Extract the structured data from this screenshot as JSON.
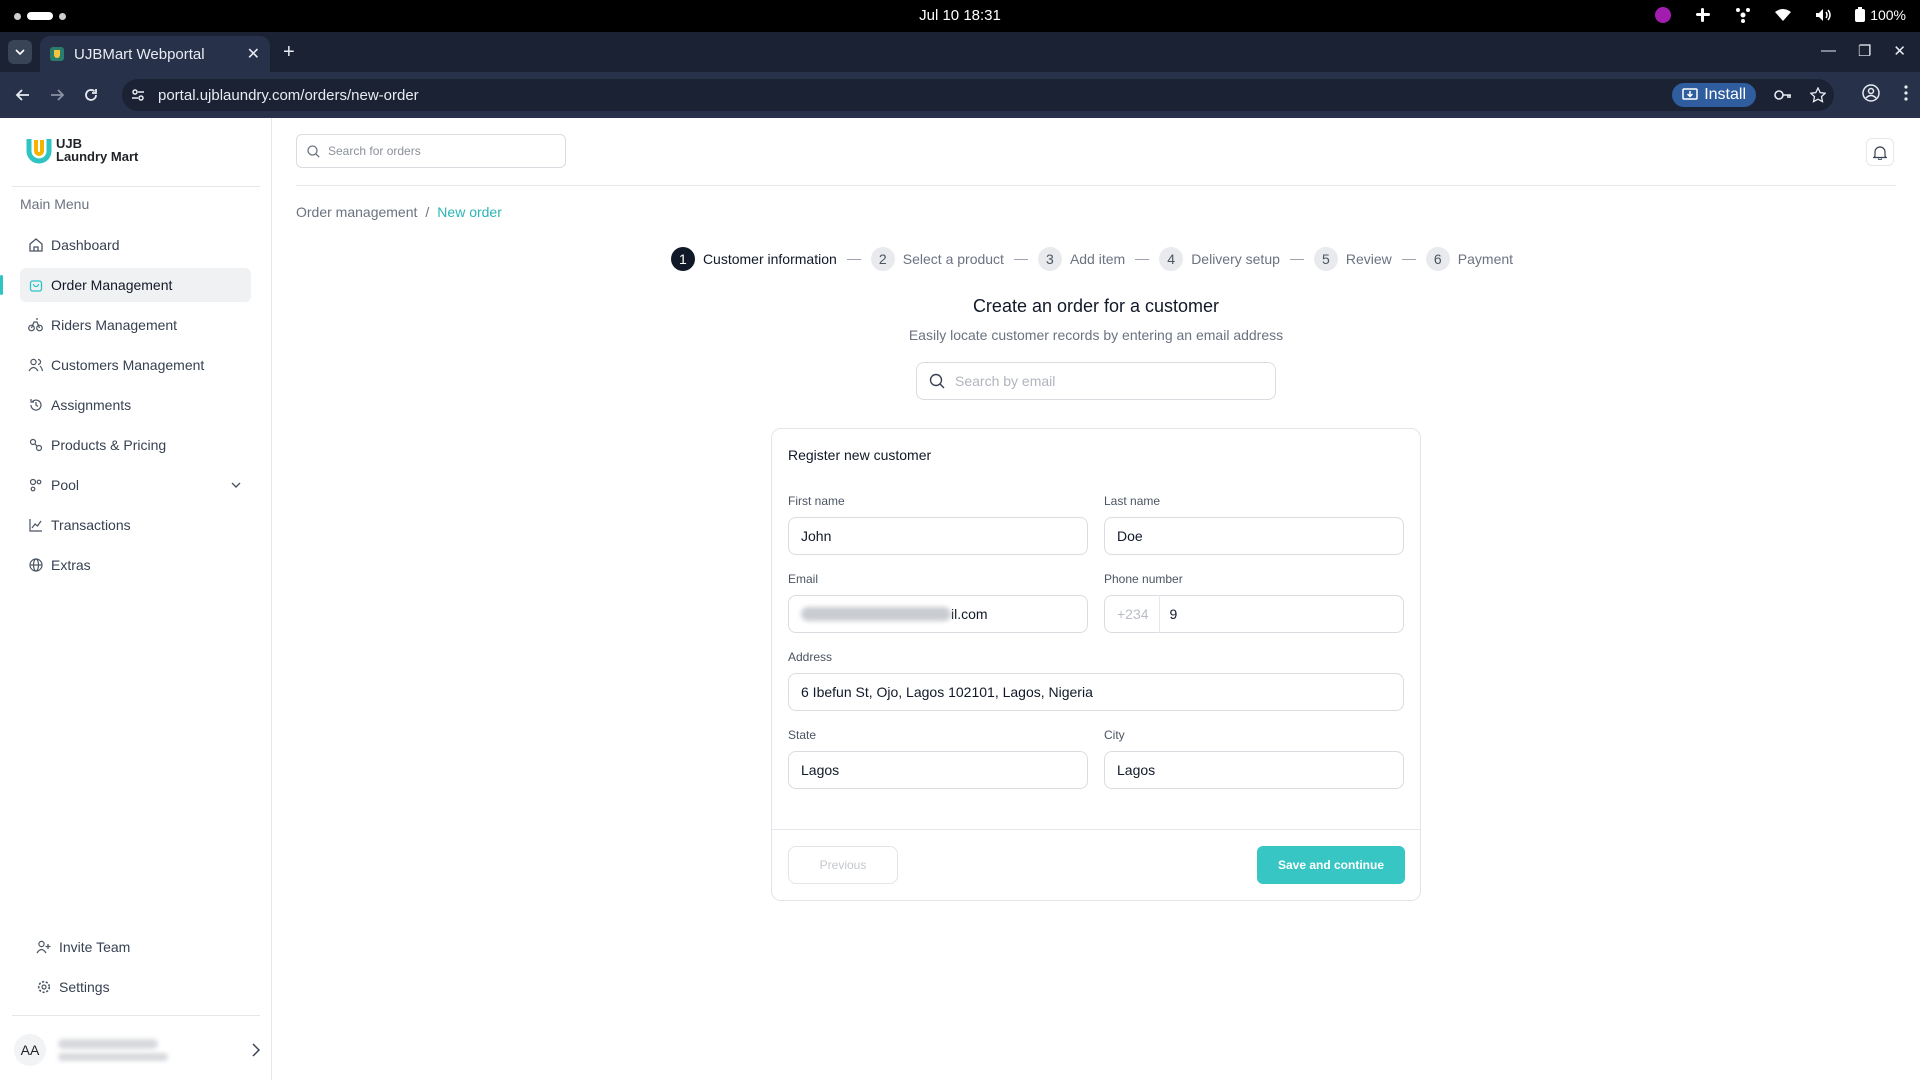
{
  "os": {
    "clock": "Jul 10  18:31",
    "battery": "100%"
  },
  "browser": {
    "tab_title": "UJBMart Webportal",
    "url": "portal.ujblaundry.com/orders/new-order",
    "install_label": "Install"
  },
  "sidebar": {
    "logo_line1": "UJB",
    "logo_line2": "Laundry Mart",
    "menu_title": "Main Menu",
    "items": [
      {
        "label": "Dashboard"
      },
      {
        "label": "Order Management"
      },
      {
        "label": "Riders Management"
      },
      {
        "label": "Customers Management"
      },
      {
        "label": "Assignments"
      },
      {
        "label": "Products & Pricing"
      },
      {
        "label": "Pool"
      },
      {
        "label": "Transactions"
      },
      {
        "label": "Extras"
      }
    ],
    "bottom": [
      {
        "label": "Invite Team"
      },
      {
        "label": "Settings"
      }
    ],
    "user_initials": "AA"
  },
  "header": {
    "search_placeholder": "Search for orders"
  },
  "breadcrumb": {
    "parent": "Order management",
    "separator": "/",
    "current": "New order"
  },
  "steps": [
    {
      "num": "1",
      "label": "Customer information"
    },
    {
      "num": "2",
      "label": "Select a product"
    },
    {
      "num": "3",
      "label": "Add item"
    },
    {
      "num": "4",
      "label": "Delivery setup"
    },
    {
      "num": "5",
      "label": "Review"
    },
    {
      "num": "6",
      "label": "Payment"
    }
  ],
  "main": {
    "title": "Create an order for a customer",
    "subtitle": "Easily locate customer records by entering an email address",
    "email_search_placeholder": "Search by email"
  },
  "form": {
    "title": "Register new customer",
    "first_name_label": "First name",
    "first_name": "John",
    "last_name_label": "Last name",
    "last_name": "Doe",
    "email_label": "Email",
    "email_visible_suffix": "il.com",
    "phone_label": "Phone number",
    "phone_prefix": "+234",
    "phone_visible_suffix": "9",
    "address_label": "Address",
    "address": "6 Ibefun St, Ojo, Lagos 102101, Lagos, Nigeria",
    "state_label": "State",
    "state": "Lagos",
    "city_label": "City",
    "city": "Lagos",
    "previous_label": "Previous",
    "save_label": "Save and continue"
  },
  "colors": {
    "accent": "#38c6c4",
    "breadcrumb_current": "#2bb5b5",
    "active_step": "#111827"
  }
}
